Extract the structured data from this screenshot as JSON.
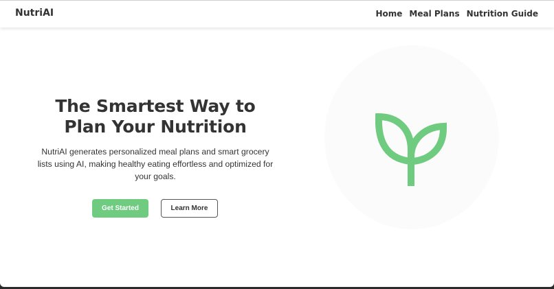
{
  "header": {
    "brand": "NutriAI",
    "nav": [
      {
        "label": "Home"
      },
      {
        "label": "Meal Plans"
      },
      {
        "label": "Nutrition Guide"
      }
    ]
  },
  "hero": {
    "headline_line1": "The Smartest Way to",
    "headline_line2": "Plan Your Nutrition",
    "description": "NutriAI generates personalized meal plans and smart grocery lists using AI, making healthy eating effortless and optimized for your goals.",
    "primary_button": "Get Started",
    "secondary_button": "Learn More",
    "illustration_icon": "sprout-icon"
  },
  "colors": {
    "accent_green": "#6ecb7f",
    "text_dark": "#333333",
    "background": "#ffffff"
  }
}
